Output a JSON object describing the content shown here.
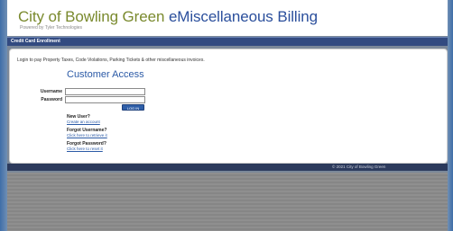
{
  "header": {
    "title_main": "City of Bowling Green",
    "title_app": "eMiscellaneous Billing",
    "powered_by": "Powered by Tyler Technologies"
  },
  "nav": {
    "item": "Credit Card Enrollment"
  },
  "main": {
    "intro": "Login to pay Property Taxes, Code Violations, Parking Tickets & other miscellaneous invoices.",
    "section_title": "Customer Access",
    "username_label": "Username",
    "password_label": "Password",
    "username_value": "",
    "password_value": "",
    "login_button": "LOG IN",
    "new_user_heading": "New User?",
    "new_user_link": "Create an account",
    "forgot_username_heading": "Forgot Username?",
    "forgot_username_link": "Click here to retrieve it",
    "forgot_password_heading": "Forgot Password?",
    "forgot_password_link": "Click here to reset it"
  },
  "footer": {
    "copyright": "© 2021 City of Bowling Green"
  },
  "colors": {
    "brand_green": "#7a8a2e",
    "brand_blue": "#2b4f9c",
    "nav_bar": "#324a80",
    "footer_bar": "#2c3a5c",
    "button": "#2f5fa8"
  }
}
